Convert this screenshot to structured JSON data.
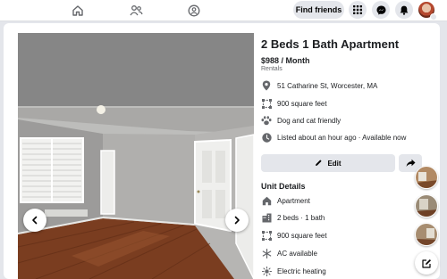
{
  "topbar": {
    "find_friends_label": "Find friends",
    "nav_icons": [
      "home-icon",
      "friends-icon",
      "groups-icon"
    ],
    "action_icons": [
      "menu-grid-icon",
      "messenger-icon",
      "notifications-bell-icon",
      "profile-avatar"
    ]
  },
  "listing": {
    "title": "2 Beds 1 Bath Apartment",
    "price": "$988 / Month",
    "category": "Rentals",
    "details": [
      {
        "icon": "location-pin-icon",
        "text": "51 Catharine St, Worcester, MA"
      },
      {
        "icon": "square-footage-icon",
        "text": "900 square feet"
      },
      {
        "icon": "paw-icon",
        "text": "Dog and cat friendly"
      },
      {
        "icon": "clock-icon",
        "text": "Listed about an hour ago · Available now"
      }
    ],
    "edit_label": "Edit",
    "unit_details_heading": "Unit Details",
    "unit_details": [
      {
        "icon": "home-outline-icon",
        "text": "Apartment"
      },
      {
        "icon": "building-icon",
        "text": "2 beds · 1 bath"
      },
      {
        "icon": "square-footage-icon",
        "text": "900 square feet"
      },
      {
        "icon": "snowflake-icon",
        "text": "AC available"
      },
      {
        "icon": "heater-icon",
        "text": "Electric heating"
      }
    ]
  },
  "gallery": {
    "prev_icon": "chevron-left-icon",
    "next_icon": "chevron-right-icon"
  },
  "colors": {
    "background": "#e4e6eb",
    "card": "#ffffff",
    "text": "#1c1e21",
    "secondary_text": "#65676b",
    "icon": "#65676b"
  }
}
